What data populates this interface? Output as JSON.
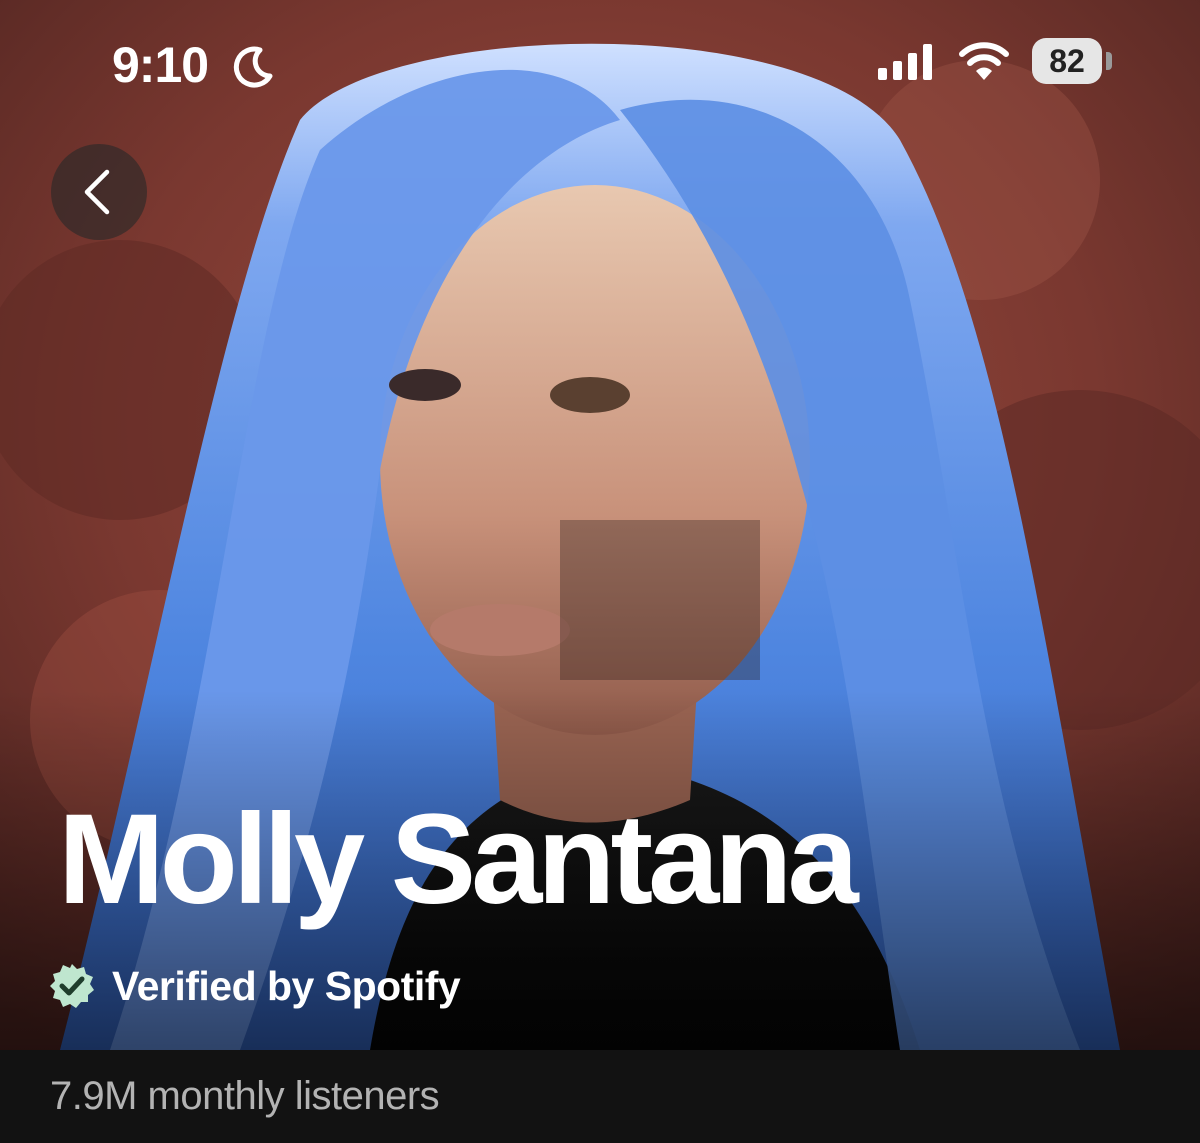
{
  "status_bar": {
    "time": "9:10",
    "battery": "82",
    "icons": [
      "moon-icon",
      "signal-icon",
      "wifi-icon",
      "battery-icon"
    ]
  },
  "navigation": {
    "back_icon": "chevron-left-icon"
  },
  "artist": {
    "name": "Molly Santana",
    "verified_label": "Verified by Spotify",
    "verified_icon": "verified-badge-icon",
    "monthly_listeners": "7.9M monthly listeners"
  },
  "colors": {
    "background": "#121212",
    "hero_backdrop": "#7a3b32",
    "hair_blue": "#5b8fe6",
    "verified_badge": "#bfe6cf",
    "secondary_text": "#b3b3b3"
  }
}
